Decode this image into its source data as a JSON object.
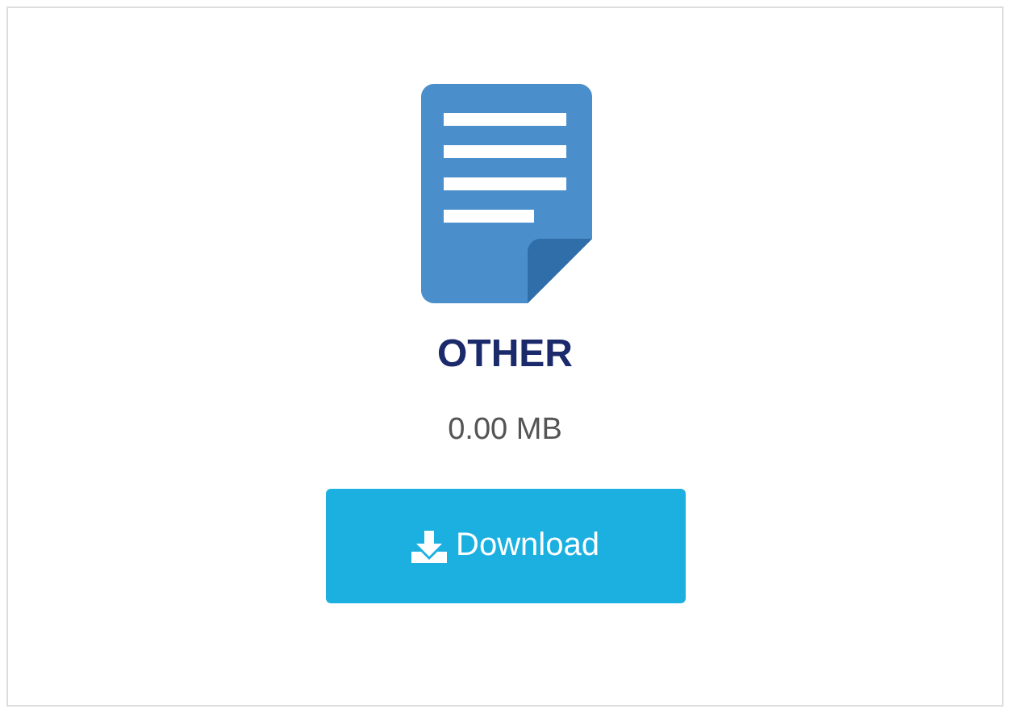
{
  "file": {
    "type": "OTHER",
    "size": "0.00 MB"
  },
  "button": {
    "label": "Download"
  }
}
